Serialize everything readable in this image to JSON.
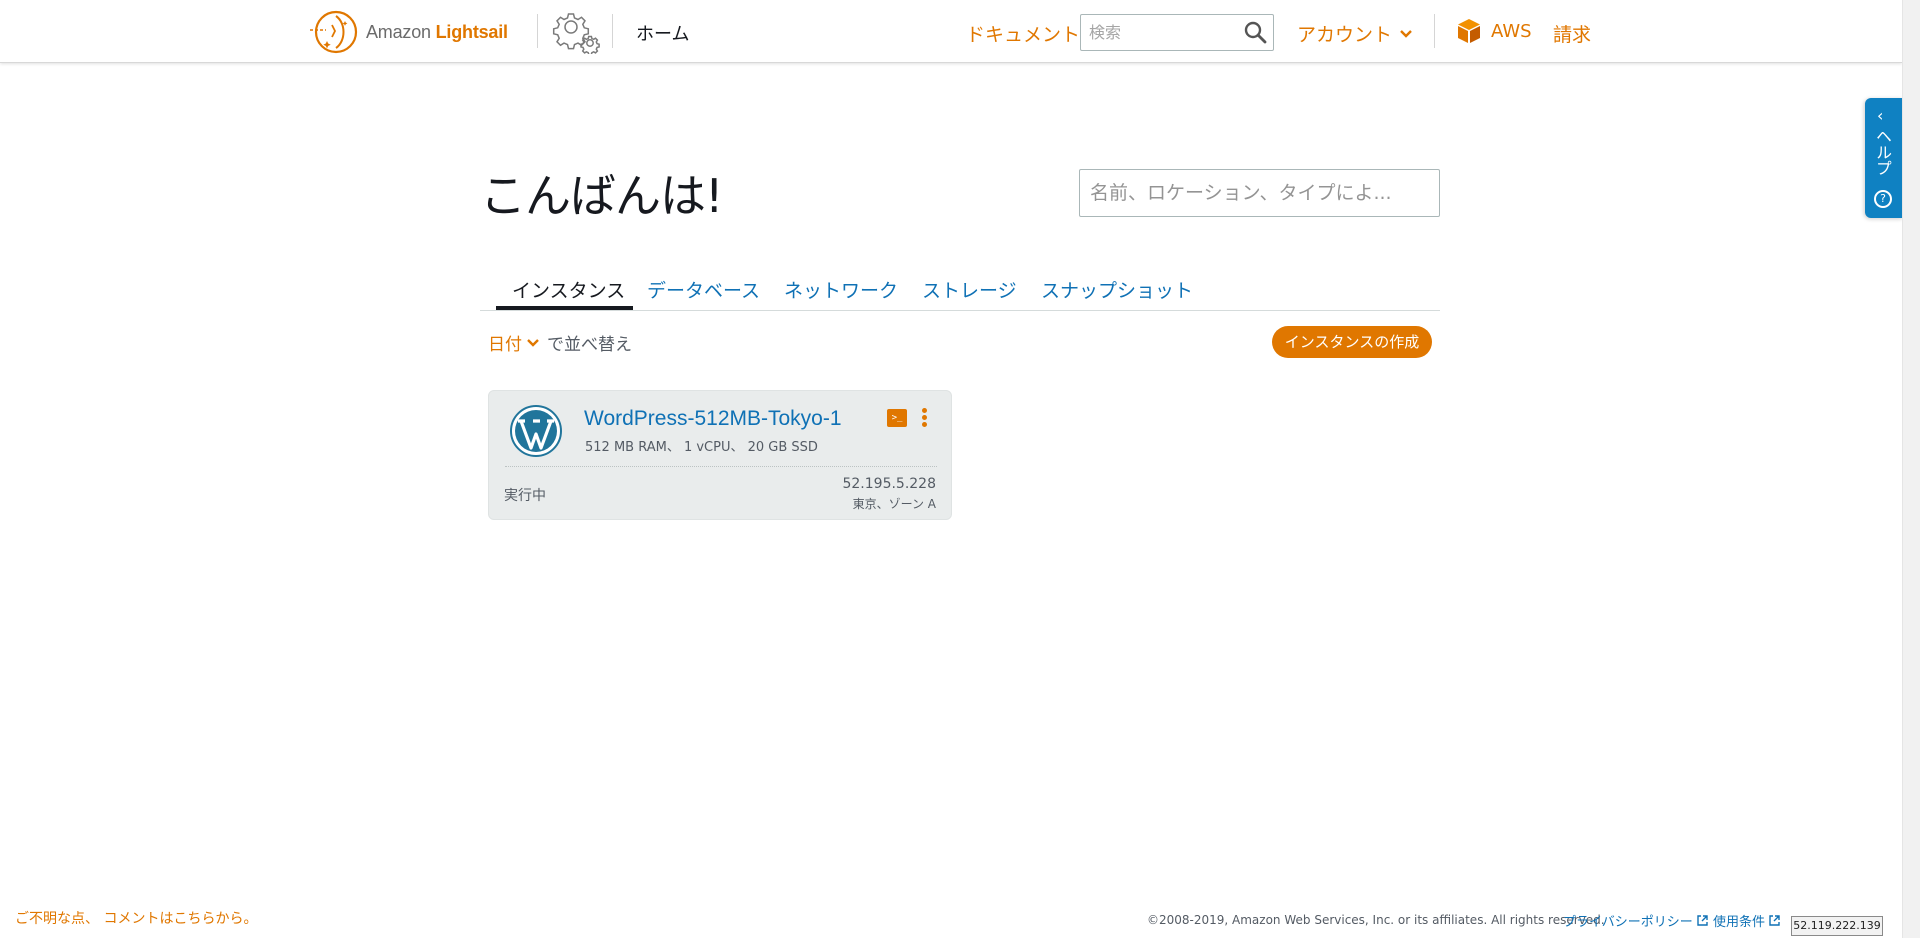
{
  "header": {
    "logo_prefix": "Amazon ",
    "logo_strong": "Lightsail",
    "home_label": "ホーム",
    "docs_label": "ドキュメント",
    "search_placeholder": "検索",
    "account_label": "アカウント",
    "aws_label": "AWS",
    "billing_label": "請求",
    "accent_color": "#e07700"
  },
  "help_tab": {
    "label": "ヘルプ",
    "arrow": "‹",
    "question_mark": "?"
  },
  "main": {
    "greeting": "こんばんは!",
    "search_placeholder": "名前、ロケーション、タイプによ...",
    "tabs": [
      {
        "label": "インスタンス",
        "active": true
      },
      {
        "label": "データベース",
        "active": false
      },
      {
        "label": "ネットワーク",
        "active": false
      },
      {
        "label": "ストレージ",
        "active": false
      },
      {
        "label": "スナップショット",
        "active": false
      }
    ],
    "sort_key": "日付",
    "sort_suffix": "で並べ替え",
    "create_button": "インスタンスの作成"
  },
  "instances": [
    {
      "name": "WordPress-512MB-Tokyo-1",
      "spec": "512 MB RAM、 1 vCPU、 20 GB SSD",
      "status": "実行中",
      "ip": "52.195.5.228",
      "location": "東京、ゾーン A",
      "icon": "wordpress-icon"
    }
  ],
  "footer": {
    "feedback": "ご不明な点、 コメントはこちらから。",
    "copyright": "©2008-2019, Amazon Web Services, Inc. or its affiliates. All rights reserved.",
    "privacy": "プライバシーポリシー",
    "terms": "使用条件",
    "ip_overlay": "52.119.222.139"
  }
}
